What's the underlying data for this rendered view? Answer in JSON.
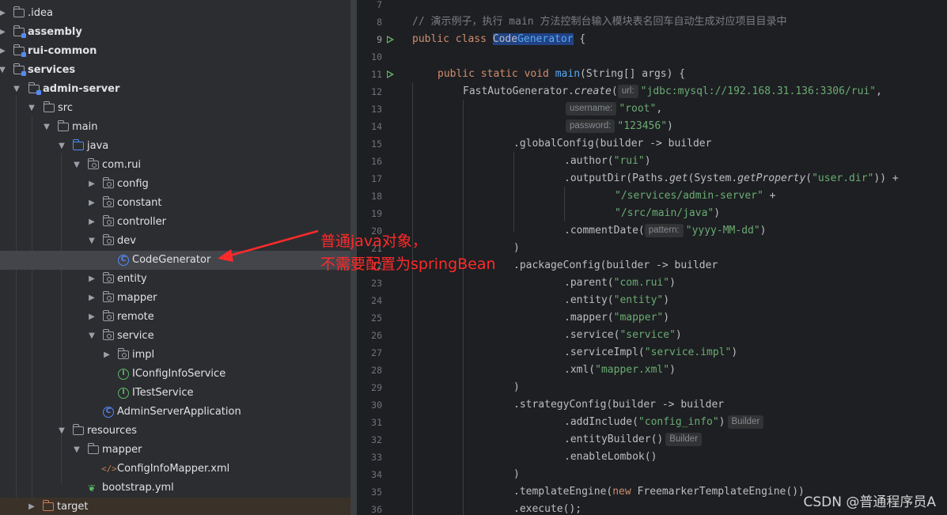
{
  "tree": {
    "items": [
      {
        "label": ".idea",
        "bold": false
      },
      {
        "label": "assembly",
        "bold": true
      },
      {
        "label": "rui-common",
        "bold": true
      },
      {
        "label": "services",
        "bold": true
      },
      {
        "label": "admin-server",
        "bold": true
      },
      {
        "label": "src",
        "bold": false
      },
      {
        "label": "main",
        "bold": false
      },
      {
        "label": "java",
        "bold": false
      },
      {
        "label": "com.rui",
        "bold": false
      },
      {
        "label": "config",
        "bold": false
      },
      {
        "label": "constant",
        "bold": false
      },
      {
        "label": "controller",
        "bold": false
      },
      {
        "label": "dev",
        "bold": false
      },
      {
        "label": "CodeGenerator",
        "bold": false
      },
      {
        "label": "entity",
        "bold": false
      },
      {
        "label": "mapper",
        "bold": false
      },
      {
        "label": "remote",
        "bold": false
      },
      {
        "label": "service",
        "bold": false
      },
      {
        "label": "impl",
        "bold": false
      },
      {
        "label": "IConfigInfoService",
        "bold": false
      },
      {
        "label": "ITestService",
        "bold": false
      },
      {
        "label": "AdminServerApplication",
        "bold": false
      },
      {
        "label": "resources",
        "bold": false
      },
      {
        "label": "mapper",
        "bold": false
      },
      {
        "label": "ConfigInfoMapper.xml",
        "bold": false
      },
      {
        "label": "bootstrap.yml",
        "bold": false
      },
      {
        "label": "target",
        "bold": false
      }
    ]
  },
  "editor": {
    "line_numbers": [
      "7",
      "8",
      "9",
      "10",
      "11",
      "12",
      "13",
      "14",
      "15",
      "16",
      "17",
      "18",
      "19",
      "20",
      "21",
      "22",
      "23",
      "24",
      "25",
      "26",
      "27",
      "28",
      "29",
      "30",
      "31",
      "32",
      "33",
      "34",
      "35",
      "36"
    ],
    "comment": "// 演示例子，执行 main 方法控制台输入模块表名回车自动生成对应项目目录中",
    "class_decl": {
      "kw": "public class ",
      "name_a": "Code",
      "name_b": "Generator",
      "rest": " {"
    },
    "main_decl": {
      "kw": "public static void ",
      "fn": "main",
      "rest": "(String[] args) {"
    },
    "hints": {
      "url": "url:",
      "username": "username:",
      "password": "password:",
      "pattern": "pattern:",
      "builder1": "Builder",
      "builder2": "Builder"
    },
    "strings": {
      "url": "\"jdbc:mysql://192.168.31.136:3306/rui\"",
      "user": "\"root\"",
      "pass": "\"123456\"",
      "author": "\"rui\"",
      "userdir": "\"user.dir\"",
      "svc": "\"/services/admin-server\"",
      "srcmain": "\"/src/main/java\"",
      "date": "\"yyyy-MM-dd\"",
      "parent": "\"com.rui\"",
      "entity": "\"entity\"",
      "mapper": "\"mapper\"",
      "service": "\"service\"",
      "serviceImpl": "\"service.impl\"",
      "xml": "\"mapper.xml\"",
      "include": "\"config_info\""
    },
    "code": {
      "fag": "FastAutoGenerator.",
      "create": "create",
      "open": "(",
      "comma": ",",
      "close": ")",
      "global": ".globalConfig(builder -> builder",
      "author": ".author(",
      "outputDir_a": ".outputDir(Paths.",
      "get": "get",
      "outputDir_b": "(System.",
      "getProperty": "getProperty",
      "outputDir_c": ")) +",
      "plus": " +",
      "commentDate": ".commentDate(",
      "rparen": ")",
      "pkg": ".packageConfig(builder -> builder",
      "parent": ".parent(",
      "entity": ".entity(",
      "mapper": ".mapper(",
      "service": ".service(",
      "serviceImpl": ".serviceImpl(",
      "xml": ".xml(",
      "strategy": ".strategyConfig(builder -> builder",
      "addInclude": ".addInclude(",
      "entityBuilder": ".entityBuilder()",
      "lombok": ".enableLombok()",
      "template_a": ".templateEngine(",
      "new": "new",
      "template_b": " FreemarkerTemplateEngine())",
      "execute": ".execute();"
    }
  },
  "annotation": {
    "line1": "普通java对象，",
    "line2": "不需要配置为springBean"
  },
  "watermark": "CSDN @普通程序员A",
  "colors": {
    "annotation": "#ff2a2a",
    "selection": "#43454a",
    "keyword": "#cf8e6d",
    "string": "#6aab73"
  }
}
